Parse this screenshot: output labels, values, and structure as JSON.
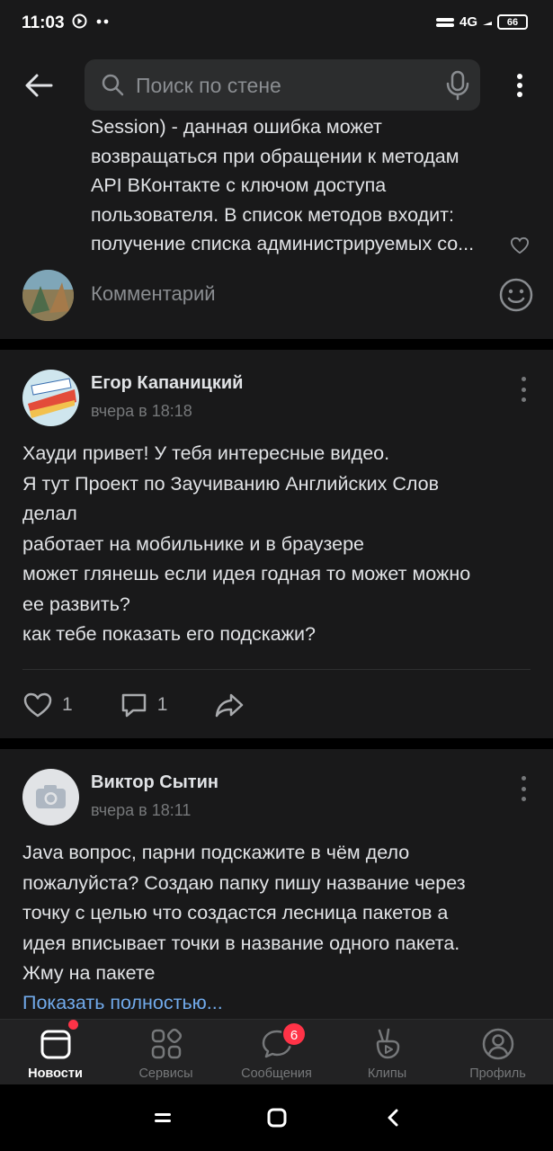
{
  "status_bar": {
    "time": "11:03",
    "network": "4G",
    "battery": "66"
  },
  "search": {
    "placeholder": "Поиск по стене"
  },
  "comment_preview": {
    "lines": [
      "Session) - данная ошибка может",
      "возвращаться при обращении к методам",
      "API ВКонтакте с ключом доступа",
      "пользователя. В список методов входит:",
      "получение списка администрируемых со..."
    ],
    "input_placeholder": "Комментарий"
  },
  "posts": [
    {
      "author": "Егор Капаницкий",
      "time": "вчера в 18:18",
      "text_lines": [
        "Хауди привет! У тебя интересные видео.",
        "Я тут Проект по Заучиванию Английских Слов",
        "делал",
        "работает на мобильнике и в браузере",
        "может глянешь если идея годная то может можно",
        "ее развить?",
        "как тебе показать его подскажи?"
      ],
      "likes": "1",
      "comments": "1"
    },
    {
      "author": "Виктор Сытин",
      "time": "вчера в 18:11",
      "text_lines": [
        "Java вопрос, парни подскажите в чём дело",
        "пожалуйста? Создаю папку пишу название через",
        "точку с целью что создастся лесница пакетов а",
        "идея вписывает точки в название одного пакета.",
        "Жму на пакете"
      ],
      "show_more": "Показать полностью..."
    }
  ],
  "bottom_nav": {
    "items": [
      {
        "label": "Новости",
        "icon": "news-icon"
      },
      {
        "label": "Сервисы",
        "icon": "services-icon"
      },
      {
        "label": "Сообщения",
        "icon": "messages-icon",
        "badge": "6"
      },
      {
        "label": "Клипы",
        "icon": "clips-icon"
      },
      {
        "label": "Профиль",
        "icon": "profile-icon"
      }
    ]
  },
  "colors": {
    "background": "#19191a",
    "accent": "#71aaeb",
    "badge": "#ff3347"
  }
}
